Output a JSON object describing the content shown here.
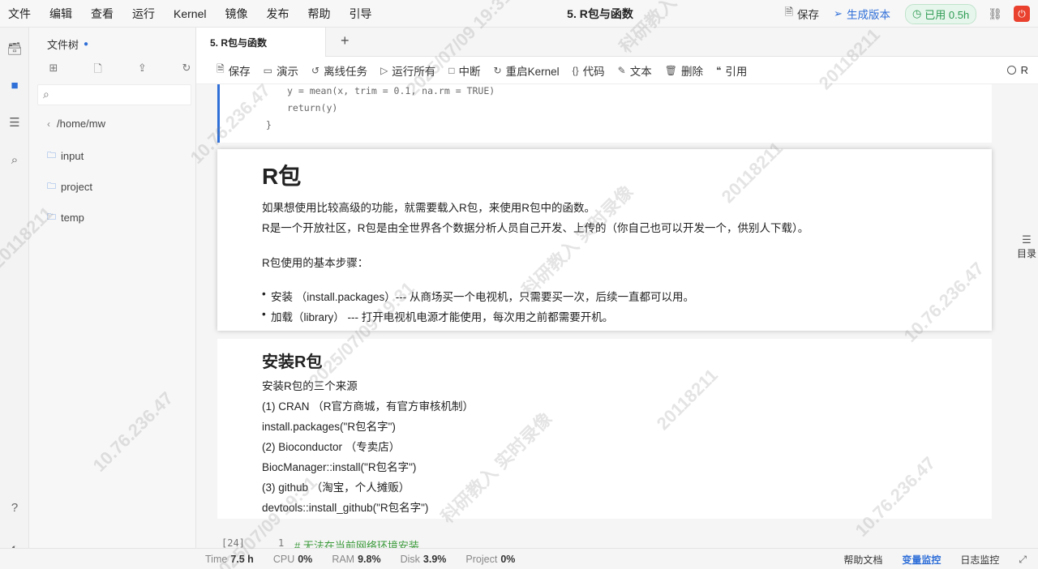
{
  "menu": {
    "items": [
      "文件",
      "编辑",
      "查看",
      "运行",
      "Kernel",
      "镜像",
      "发布",
      "帮助",
      "引导"
    ],
    "doc_title": "5. R包与函数",
    "save_label": "保存",
    "publish_label": "生成版本",
    "usage_label": "已用 0.5h"
  },
  "filetree": {
    "title": "文件树",
    "search_placeholder": "",
    "path": "/home/mw",
    "items": [
      "input",
      "project",
      "temp"
    ]
  },
  "tabs": [
    {
      "label": "5. R包与函数"
    }
  ],
  "toolbar": {
    "save": "保存",
    "present": "演示",
    "offline": "离线任务",
    "run_all": "运行所有",
    "interrupt": "中断",
    "restart": "重启Kernel",
    "code": "代码",
    "text": "文本",
    "delete": "删除",
    "cite": "引用",
    "kernel": "R"
  },
  "cells": {
    "code_lines": [
      "y = mean(x, trim = 0.1, na.rm = TRUE)",
      "return(y)",
      "}"
    ],
    "md1": {
      "heading": "R包",
      "p1": "如果想使用比较高级的功能，就需要载入R包，来使用R包中的函数。",
      "p2": "R是一个开放社区，R包是由全世界各个数据分析人员自己开发、上传的（你自己也可以开发一个，供别人下载）。",
      "p3": "R包使用的基本步骤：",
      "li1": "安装 （install.packages）--- 从商场买一个电视机，只需要买一次，后续一直都可以用。",
      "li2": "加载（library） --- 打开电视机电源才能使用，每次用之前都需要开机。"
    },
    "md2": {
      "heading": "安装R包",
      "lines": [
        "安装R包的三个来源",
        "(1) CRAN （R官方商城，有官方审核机制）",
        "install.packages(\"R包名字\")",
        "(2) Bioconductor （专卖店）",
        "BiocManager::install(\"R包名字\")",
        "(3) github （淘宝，个人摊贩）",
        "devtools::install_github(\"R包名字\")"
      ]
    },
    "code2": {
      "prompt": "[24]",
      "line_no": "1",
      "comment": "# 无法在当前网络环境安装"
    }
  },
  "outline": {
    "label": "目录"
  },
  "status": {
    "time_label": "Time",
    "time_value": "7.5 h",
    "cpu_label": "CPU",
    "cpu_value": "0%",
    "ram_label": "RAM",
    "ram_value": "9.8%",
    "disk_label": "Disk",
    "disk_value": "3.9%",
    "project_label": "Project",
    "project_value": "0%",
    "help_doc": "帮助文档",
    "var_monitor": "变量监控",
    "log_monitor": "日志监控"
  },
  "watermark": {
    "lines": [
      "20118211",
      "10.76.236.47",
      "2025/07/09 19:31",
      "科研教入 实时录像"
    ]
  },
  "colors": {
    "accent": "#2f6fd8",
    "usage_green": "#2b9a52",
    "power_red": "#e9412e"
  },
  "icons": {
    "rail": [
      "inbox-icon",
      "folder-icon",
      "database-icon",
      "search-doc-icon",
      "help-icon",
      "theme-toggle-icon"
    ]
  }
}
